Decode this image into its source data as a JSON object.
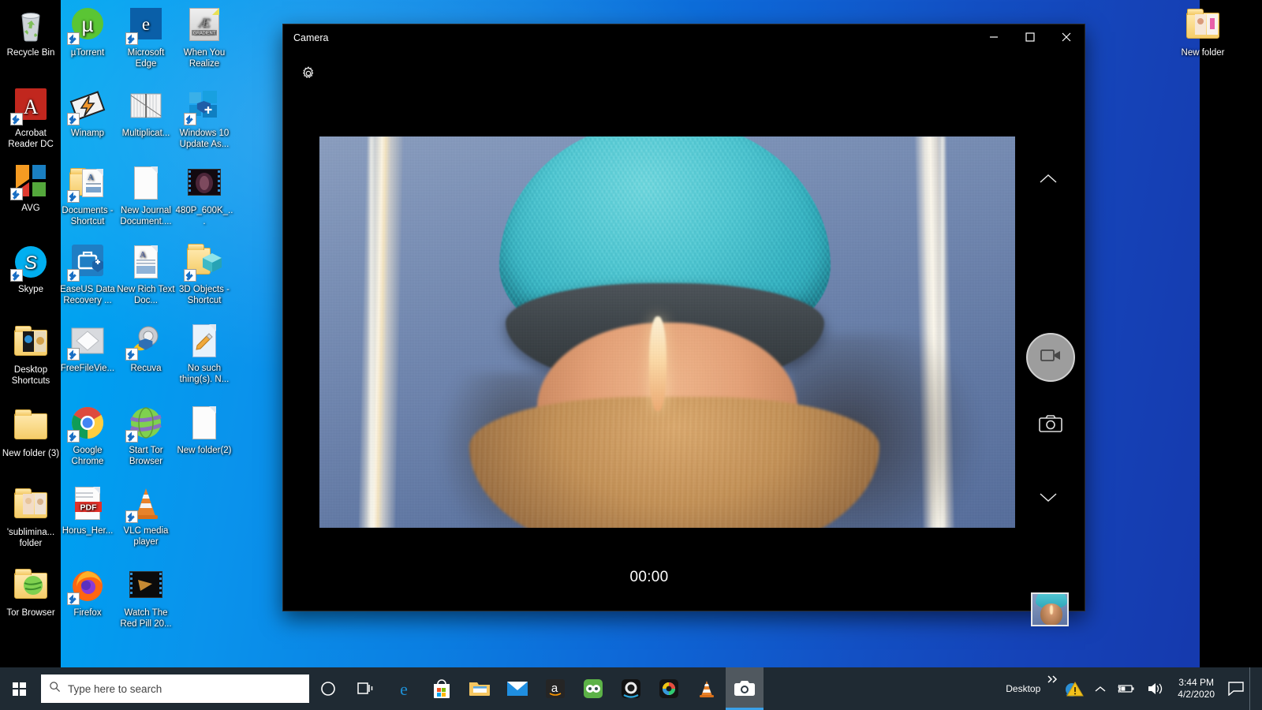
{
  "desktop": {
    "icons_left_column": [
      {
        "label": "Recycle Bin",
        "icon": "recycle-bin-icon",
        "shortcut": false
      },
      {
        "label": "Acrobat Reader DC",
        "icon": "acrobat-reader-icon",
        "shortcut": true
      },
      {
        "label": "AVG",
        "icon": "avg-icon",
        "shortcut": true
      },
      {
        "label": "Skype",
        "icon": "skype-icon",
        "shortcut": true
      },
      {
        "label": "Desktop Shortcuts",
        "icon": "folder-pictures-icon",
        "shortcut": false
      },
      {
        "label": "New folder (3)",
        "icon": "folder-icon",
        "shortcut": false
      },
      {
        "label": "'sublimina... folder",
        "icon": "folder-pictures-icon",
        "shortcut": false
      },
      {
        "label": "Tor Browser",
        "icon": "folder-globe-icon",
        "shortcut": false
      }
    ],
    "icons_grid": [
      {
        "label": "µTorrent",
        "icon": "utorrent-icon",
        "shortcut": true
      },
      {
        "label": "Microsoft Edge",
        "icon": "edge-icon",
        "shortcut": true
      },
      {
        "label": "When You Realize",
        "icon": "gradient-document-icon",
        "shortcut": false
      },
      {
        "label": "Winamp",
        "icon": "winamp-icon",
        "shortcut": true
      },
      {
        "label": "Multiplicat...",
        "icon": "spreadsheet-chart-icon",
        "shortcut": false
      },
      {
        "label": "Windows 10 Update As...",
        "icon": "windows-update-icon",
        "shortcut": true
      },
      {
        "label": "Documents - Shortcut",
        "icon": "documents-folder-icon",
        "shortcut": true
      },
      {
        "label": "New Journal Document....",
        "icon": "blank-document-icon",
        "shortcut": false
      },
      {
        "label": "480P_600K_...",
        "icon": "video-file-icon",
        "shortcut": false
      },
      {
        "label": "EaseUS Data Recovery ...",
        "icon": "easeus-icon",
        "shortcut": true
      },
      {
        "label": "New Rich Text Doc...",
        "icon": "rich-text-document-icon",
        "shortcut": false
      },
      {
        "label": "3D Objects - Shortcut",
        "icon": "3d-objects-folder-icon",
        "shortcut": true
      },
      {
        "label": "FreeFileVie...",
        "icon": "freefileviewer-icon",
        "shortcut": true
      },
      {
        "label": "Recuva",
        "icon": "recuva-icon",
        "shortcut": true
      },
      {
        "label": "No such thing(s). N...",
        "icon": "wordpad-document-icon",
        "shortcut": false
      },
      {
        "label": "Google Chrome",
        "icon": "chrome-icon",
        "shortcut": true
      },
      {
        "label": "Start Tor Browser",
        "icon": "tor-browser-icon",
        "shortcut": true
      },
      {
        "label": "New folder(2)",
        "icon": "blank-document-icon",
        "shortcut": false
      },
      {
        "label": "Horus_Her...",
        "icon": "pdf-file-icon",
        "shortcut": false
      },
      {
        "label": "VLC media player",
        "icon": "vlc-icon",
        "shortcut": true
      },
      {
        "label": "Firefox",
        "icon": "firefox-icon",
        "shortcut": true
      },
      {
        "label": "Watch The Red Pill 20...",
        "icon": "video-file-icon",
        "shortcut": false
      }
    ],
    "icon_right": {
      "label": "New folder",
      "icon": "folder-pictures-icon",
      "shortcut": false
    }
  },
  "camera_window": {
    "title": "Camera",
    "titlebar_buttons": {
      "minimize": "minimize-icon",
      "maximize": "maximize-icon",
      "close": "close-icon"
    },
    "settings_icon": "gear-icon",
    "controls": {
      "scroll_up_icon": "chevron-up-icon",
      "scroll_down_icon": "chevron-down-icon",
      "record_icon": "video-camera-icon",
      "photo_icon": "photo-camera-icon",
      "thumbnail_label": "last-capture-thumbnail"
    },
    "timer": "00:00"
  },
  "taskbar": {
    "start_icon": "windows-start-icon",
    "search": {
      "placeholder": "Type here to search",
      "value": "",
      "icon": "search-icon"
    },
    "pinned": [
      {
        "name": "cortana-icon",
        "label": "Cortana"
      },
      {
        "name": "task-view-icon",
        "label": "Task View"
      },
      {
        "name": "edge-icon",
        "label": "Microsoft Edge"
      },
      {
        "name": "microsoft-store-icon",
        "label": "Microsoft Store"
      },
      {
        "name": "file-explorer-icon",
        "label": "File Explorer"
      },
      {
        "name": "mail-icon",
        "label": "Mail"
      },
      {
        "name": "amazon-icon",
        "label": "Amazon"
      },
      {
        "name": "tripadvisor-icon",
        "label": "TripAdvisor"
      },
      {
        "name": "camera-lens-icon",
        "label": "Camera app"
      },
      {
        "name": "colorful-camera-icon",
        "label": "Photo app"
      },
      {
        "name": "vlc-icon",
        "label": "VLC media player"
      },
      {
        "name": "camera-app-icon",
        "label": "Camera",
        "active": true
      }
    ],
    "tray": {
      "desktop_label": "Desktop",
      "overflow_icon": "chevron-double-right-icon",
      "warning_icon": "warning-triangle-icon",
      "show_hidden_icon": "chevron-up-icon",
      "battery_icon": "battery-icon",
      "volume_icon": "volume-icon",
      "time": "3:44 PM",
      "date": "4/2/2020",
      "action_center_icon": "action-center-icon"
    }
  }
}
